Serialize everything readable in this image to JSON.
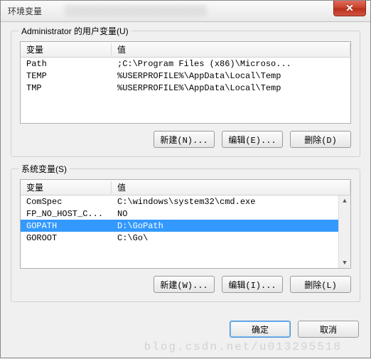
{
  "window": {
    "title": "环境变量",
    "close_label": "✕"
  },
  "user_group": {
    "legend": "Administrator 的用户变量(U)",
    "columns": {
      "var": "变量",
      "val": "值"
    },
    "rows": [
      {
        "var": "Path",
        "val": ";C:\\Program Files (x86)\\Microso..."
      },
      {
        "var": "TEMP",
        "val": "%USERPROFILE%\\AppData\\Local\\Temp"
      },
      {
        "var": "TMP",
        "val": "%USERPROFILE%\\AppData\\Local\\Temp"
      }
    ],
    "buttons": {
      "new": "新建(N)...",
      "edit": "编辑(E)...",
      "delete": "删除(D)"
    }
  },
  "sys_group": {
    "legend": "系统变量(S)",
    "columns": {
      "var": "变量",
      "val": "值"
    },
    "rows": [
      {
        "var": "ComSpec",
        "val": "C:\\windows\\system32\\cmd.exe",
        "selected": false
      },
      {
        "var": "FP_NO_HOST_C...",
        "val": "NO",
        "selected": false
      },
      {
        "var": "GOPATH",
        "val": "D:\\GoPath",
        "selected": true
      },
      {
        "var": "GOROOT",
        "val": "C:\\Go\\",
        "selected": false
      }
    ],
    "buttons": {
      "new": "新建(W)...",
      "edit": "编辑(I)...",
      "delete": "删除(L)"
    }
  },
  "footer": {
    "ok": "确定",
    "cancel": "取消"
  },
  "watermark": "blog.csdn.net/u013295518"
}
